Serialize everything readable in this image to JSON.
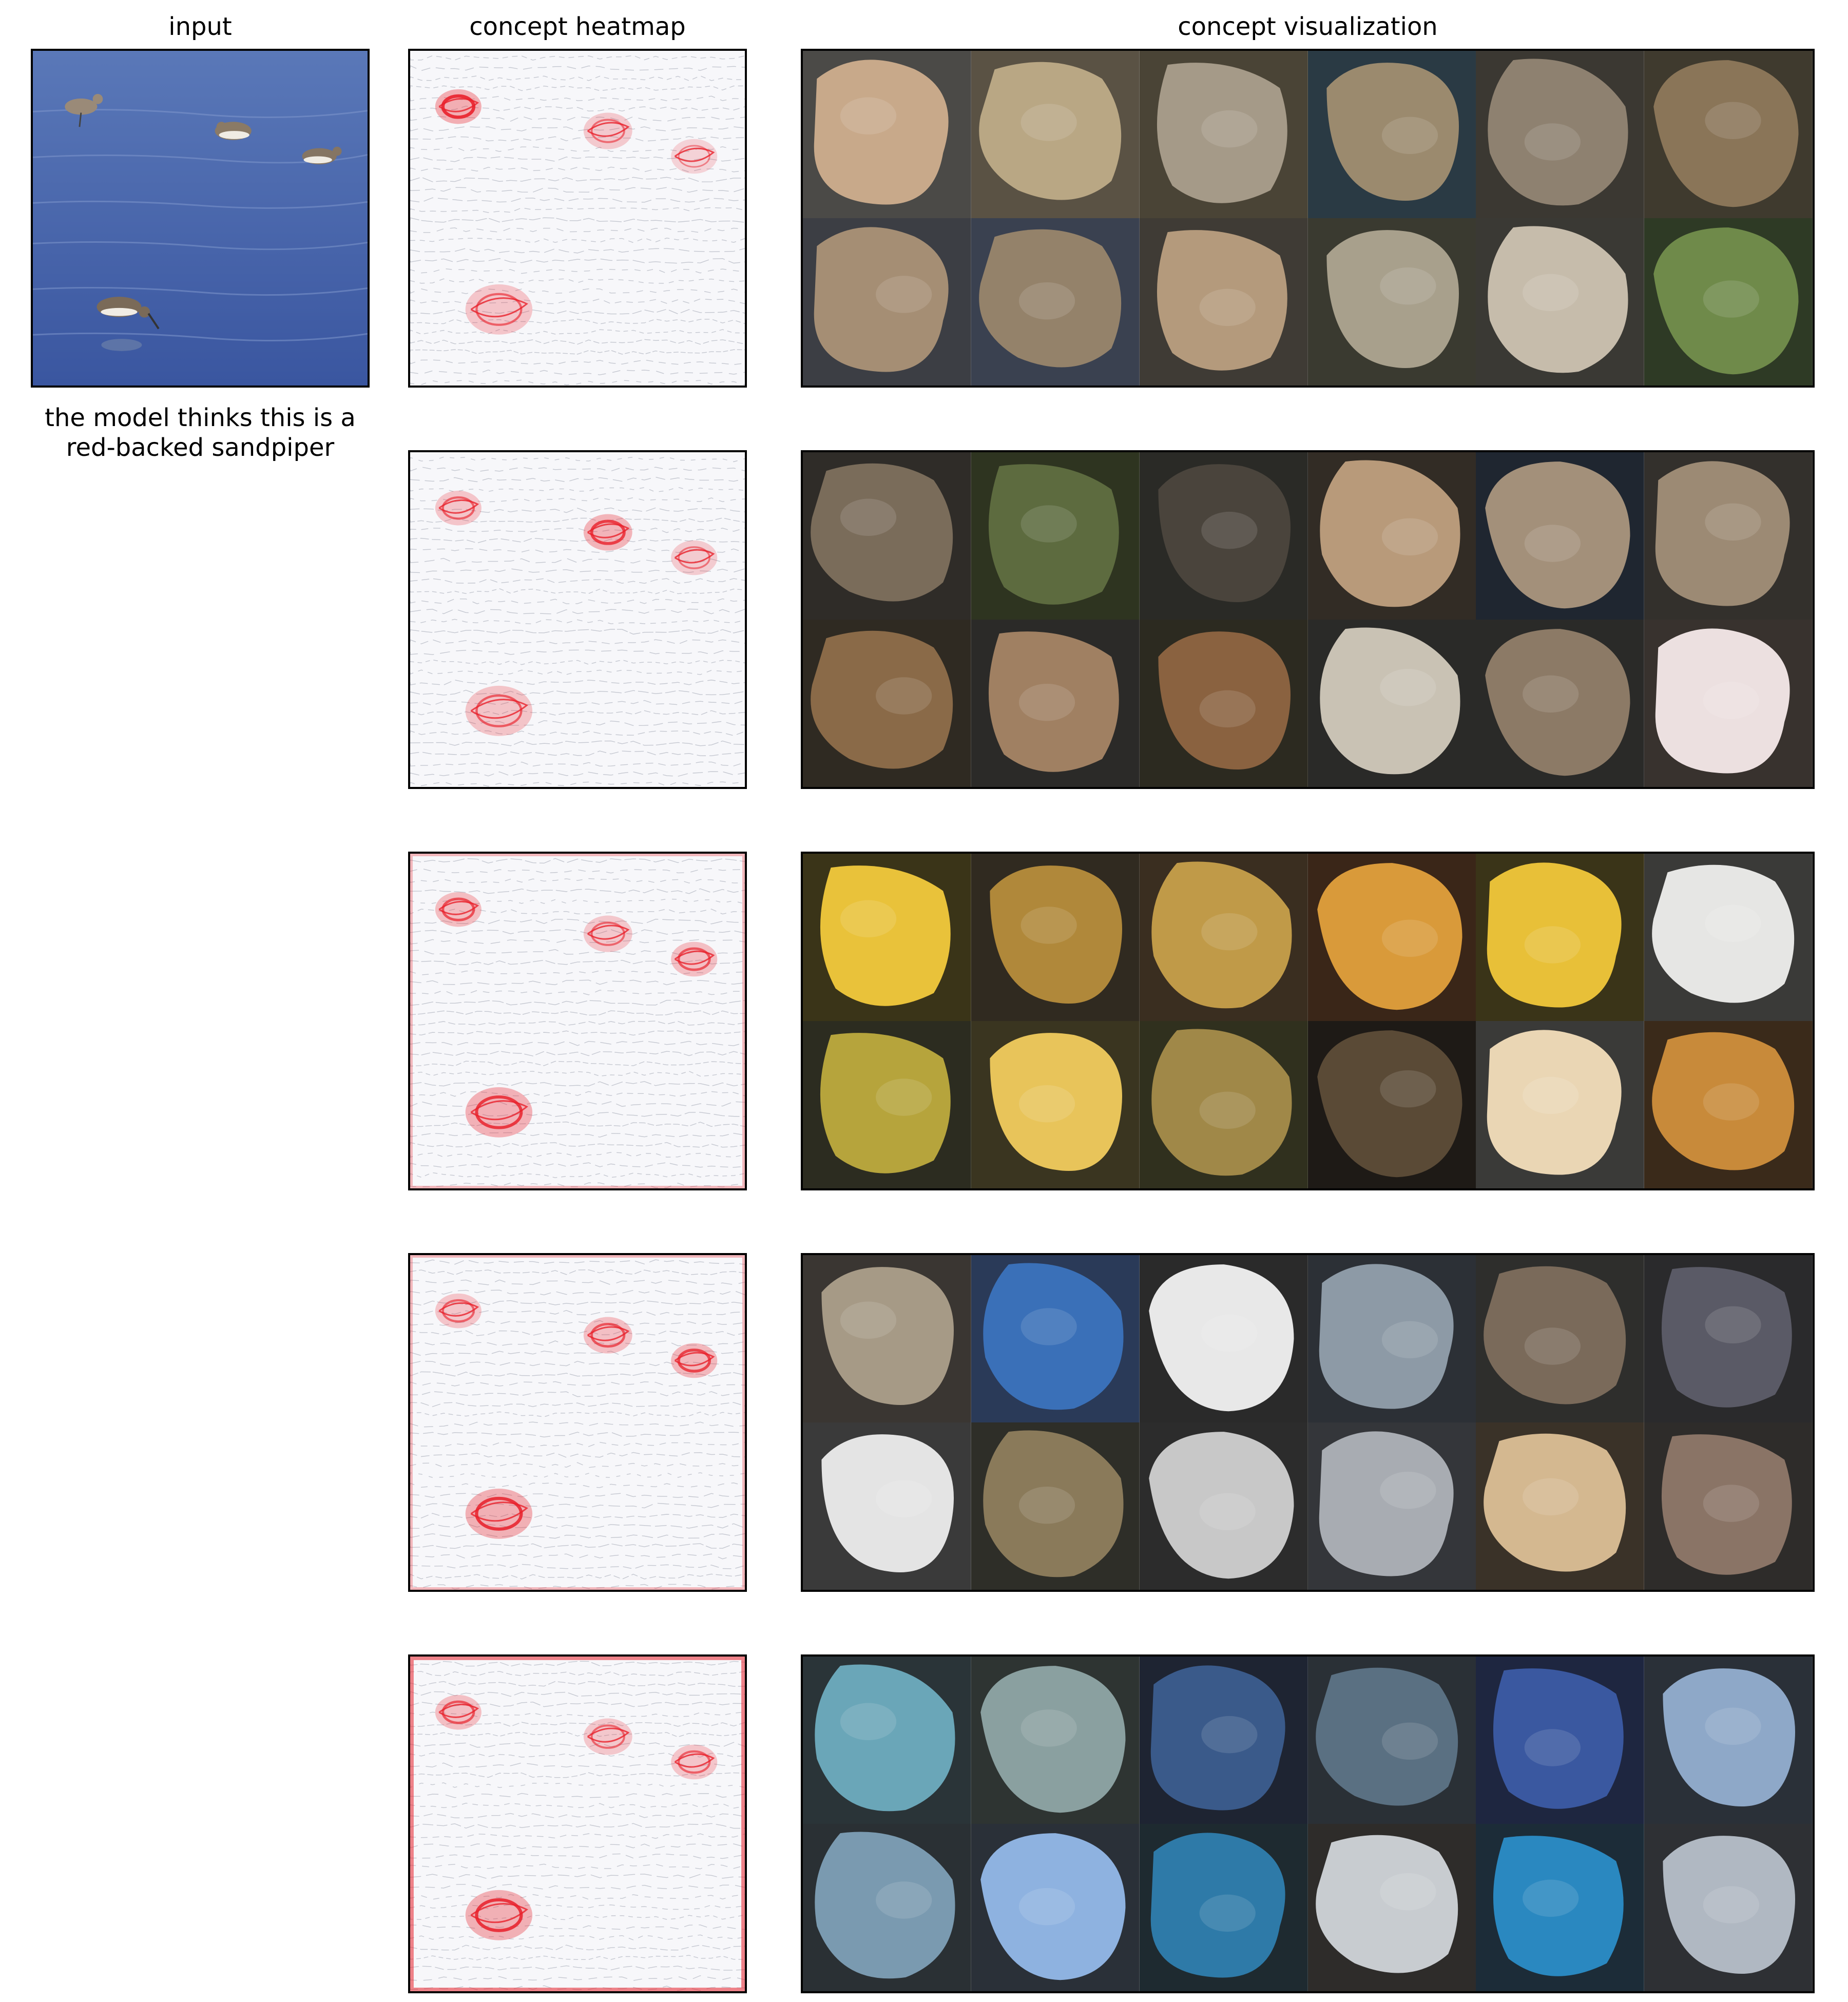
{
  "headers": {
    "input": "input",
    "heatmap": "concept heatmap",
    "visualization": "concept visualization"
  },
  "caption": "the model thinks this is a red-backed sandpiper",
  "colors": {
    "heat": "#e8202a",
    "water": "#3f5fa8",
    "dim_background": "#34302c"
  },
  "concepts": [
    {
      "tiles": [
        {
          "bg": "#4b4a47",
          "fg": "#c8a98a"
        },
        {
          "bg": "#5a5244",
          "fg": "#b9a784"
        },
        {
          "bg": "#4a4436",
          "fg": "#a59a88"
        },
        {
          "bg": "#2a3a44",
          "fg": "#9b8a6e"
        },
        {
          "bg": "#3b3832",
          "fg": "#8e8170"
        },
        {
          "bg": "#3f3a2e",
          "fg": "#8a7558"
        },
        {
          "bg": "#3c3e44",
          "fg": "#a58e74"
        },
        {
          "bg": "#3a4150",
          "fg": "#94826a"
        },
        {
          "bg": "#3f3b35",
          "fg": "#b49a7c"
        },
        {
          "bg": "#3a3a30",
          "fg": "#a8a08c"
        },
        {
          "bg": "#3a3934",
          "fg": "#c6bcab"
        },
        {
          "bg": "#2e3a25",
          "fg": "#6f8a4a"
        }
      ]
    },
    {
      "tiles": [
        {
          "bg": "#2f2c28",
          "fg": "#7a6c5a"
        },
        {
          "bg": "#2e3420",
          "fg": "#5d6b3f"
        },
        {
          "bg": "#2a2a26",
          "fg": "#4a443c"
        },
        {
          "bg": "#322c25",
          "fg": "#b89a7a"
        },
        {
          "bg": "#1f2630",
          "fg": "#a3907a"
        },
        {
          "bg": "#33302c",
          "fg": "#9c8a74"
        },
        {
          "bg": "#2f2a22",
          "fg": "#8a6a48"
        },
        {
          "bg": "#2b2a28",
          "fg": "#a08062"
        },
        {
          "bg": "#2c2a20",
          "fg": "#8a6240"
        },
        {
          "bg": "#2a2a28",
          "fg": "#c9c2b4"
        },
        {
          "bg": "#2a2a28",
          "fg": "#8c7a66"
        },
        {
          "bg": "#38322e",
          "fg": "#ece0e0"
        }
      ]
    },
    {
      "tiles": [
        {
          "bg": "#3a3418",
          "fg": "#e9c23a"
        },
        {
          "bg": "#302a20",
          "fg": "#b0883a"
        },
        {
          "bg": "#3a2e20",
          "fg": "#c09a48"
        },
        {
          "bg": "#3a2618",
          "fg": "#d99a3a"
        },
        {
          "bg": "#3a3418",
          "fg": "#e8c038"
        },
        {
          "bg": "#3a3a38",
          "fg": "#e6e6e4"
        },
        {
          "bg": "#2c2c20",
          "fg": "#b6a43c"
        },
        {
          "bg": "#3a3520",
          "fg": "#e8c45a"
        },
        {
          "bg": "#30301e",
          "fg": "#a08848"
        },
        {
          "bg": "#1e1a16",
          "fg": "#5a4a36"
        },
        {
          "bg": "#3a3a38",
          "fg": "#ead6b4"
        },
        {
          "bg": "#3a2a1a",
          "fg": "#c88a3a"
        }
      ]
    },
    {
      "tiles": [
        {
          "bg": "#3a3632",
          "fg": "#a69a86"
        },
        {
          "bg": "#2a3a58",
          "fg": "#3a70b8"
        },
        {
          "bg": "#2a2a2a",
          "fg": "#e8e8e8"
        },
        {
          "bg": "#2c3036",
          "fg": "#8d9aa6"
        },
        {
          "bg": "#2e2e2c",
          "fg": "#7a6a5a"
        },
        {
          "bg": "#2a2a2c",
          "fg": "#5a5a66"
        },
        {
          "bg": "#3a3a3a",
          "fg": "#e4e4e4"
        },
        {
          "bg": "#2e2e28",
          "fg": "#8a7a5a"
        },
        {
          "bg": "#2c2c2c",
          "fg": "#c8c8c8"
        },
        {
          "bg": "#34363a",
          "fg": "#a8acb2"
        },
        {
          "bg": "#3a3228",
          "fg": "#d4b890"
        },
        {
          "bg": "#2e2c2a",
          "fg": "#8a7466"
        }
      ]
    },
    {
      "tiles": [
        {
          "bg": "#2a3438",
          "fg": "#6aa6b8"
        },
        {
          "bg": "#2e3432",
          "fg": "#8aa0a0"
        },
        {
          "bg": "#1e2432",
          "fg": "#3a5a8a"
        },
        {
          "bg": "#2a3036",
          "fg": "#5a7082"
        },
        {
          "bg": "#1e2640",
          "fg": "#3a58a0"
        },
        {
          "bg": "#2a3038",
          "fg": "#8ea8c8"
        },
        {
          "bg": "#2a3034",
          "fg": "#7a9ab0"
        },
        {
          "bg": "#2a3038",
          "fg": "#8eb2e0"
        },
        {
          "bg": "#1e2a30",
          "fg": "#2e7aa8"
        },
        {
          "bg": "#2e2c2a",
          "fg": "#c8ccd0"
        },
        {
          "bg": "#1c2c38",
          "fg": "#2a88c0"
        },
        {
          "bg": "#2e3034",
          "fg": "#b0b8c2"
        }
      ]
    }
  ]
}
